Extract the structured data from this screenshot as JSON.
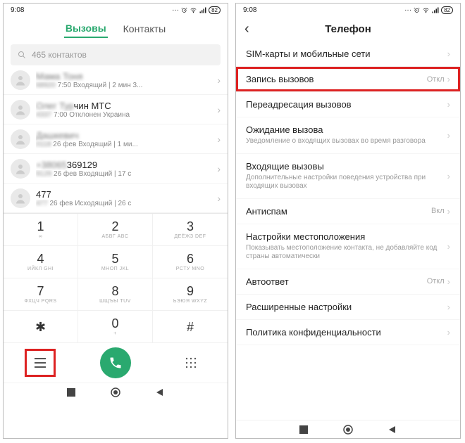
{
  "status": {
    "time": "9:08",
    "battery": "82"
  },
  "left": {
    "tabs": {
      "calls": "Вызовы",
      "contacts": "Контакты"
    },
    "search_placeholder": "465 контактов",
    "calls": [
      {
        "name_blur": "Мама Тоня",
        "name": "",
        "meta_blur": "68920",
        "meta": " 7:50 Входящий | 2 мин 3..."
      },
      {
        "name_blur": "Олег Тур",
        "name": "чин МТС",
        "meta_blur": "4337",
        "meta": " 7:00 Отклонен Украина"
      },
      {
        "name_blur": "Дашкевич",
        "name": "",
        "meta_blur": "0118",
        "meta": " 26 фев Входящий | 1 ми..."
      },
      {
        "name_blur": "+38065",
        "name": "369129",
        "meta_blur": "9129",
        "meta": " 26 фев Входящий | 17 с"
      },
      {
        "name_blur": "",
        "name": "477",
        "meta_blur": "477",
        "meta": " 26 фев Исходящий | 26 с"
      }
    ],
    "keys": [
      {
        "num": "1",
        "let": "∞"
      },
      {
        "num": "2",
        "let": "АБВГ ABC"
      },
      {
        "num": "3",
        "let": "ДЕЁЖЗ DEF"
      },
      {
        "num": "4",
        "let": "ИЙКЛ GHI"
      },
      {
        "num": "5",
        "let": "МНОП JKL"
      },
      {
        "num": "6",
        "let": "РСТУ MNO"
      },
      {
        "num": "7",
        "let": "ФХЦЧ PQRS"
      },
      {
        "num": "8",
        "let": "ШЩЪЫ TUV"
      },
      {
        "num": "9",
        "let": "ЬЭЮЯ WXYZ"
      },
      {
        "num": "✱",
        "let": ""
      },
      {
        "num": "0",
        "let": "+"
      },
      {
        "num": "#",
        "let": ""
      }
    ]
  },
  "right": {
    "title": "Телефон",
    "items": [
      {
        "label": "SIM-карты и мобильные сети",
        "desc": "",
        "value": ""
      },
      {
        "label": "Запись вызовов",
        "desc": "",
        "value": "Откл",
        "highlight": true
      },
      {
        "label": "Переадресация вызовов",
        "desc": "",
        "value": ""
      },
      {
        "label": "Ожидание вызова",
        "desc": "Уведомление о входящих вызовах во время разговора",
        "value": ""
      },
      {
        "label": "Входящие вызовы",
        "desc": "Дополнительные настройки поведения устройства при входящих вызовах",
        "value": ""
      },
      {
        "label": "Антиспам",
        "desc": "",
        "value": "Вкл"
      },
      {
        "label": "Настройки местоположения",
        "desc": "Показывать местоположение контакта, не добавляйте код страны автоматически",
        "value": ""
      },
      {
        "label": "Автоответ",
        "desc": "",
        "value": "Откл"
      },
      {
        "label": "Расширенные настройки",
        "desc": "",
        "value": ""
      },
      {
        "label": "Политика конфиденциальности",
        "desc": "",
        "value": ""
      }
    ]
  }
}
